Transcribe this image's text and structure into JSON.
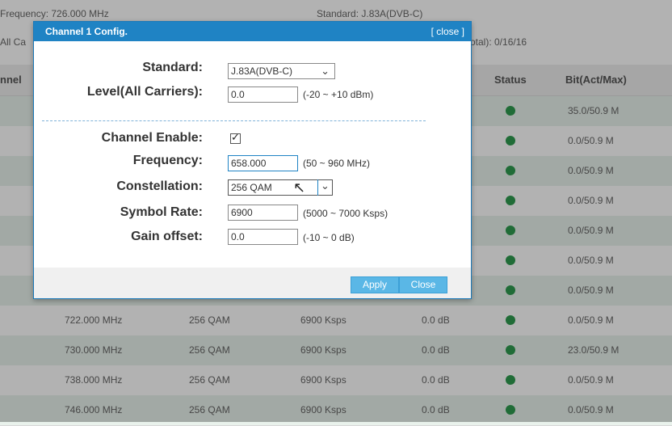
{
  "background": {
    "frequency_info": "Frequency: 726.000 MHz",
    "standard_info": "Standard: J.83A(DVB-C)",
    "carriers_info": "All Ca",
    "total_info": "otal): 0/16/16",
    "columns": {
      "channel": "nnel",
      "status": "Status",
      "bit": "Bit(Act/Max)"
    },
    "rows": [
      {
        "freq": "",
        "const": "",
        "rate": "",
        "gain": "",
        "bit": "35.0/50.9 M"
      },
      {
        "freq": "",
        "const": "",
        "rate": "",
        "gain": "",
        "bit": "0.0/50.9 M"
      },
      {
        "freq": "",
        "const": "",
        "rate": "",
        "gain": "",
        "bit": "0.0/50.9 M"
      },
      {
        "freq": "",
        "const": "",
        "rate": "",
        "gain": "",
        "bit": "0.0/50.9 M"
      },
      {
        "freq": "",
        "const": "",
        "rate": "",
        "gain": "",
        "bit": "0.0/50.9 M"
      },
      {
        "freq": "",
        "const": "",
        "rate": "",
        "gain": "",
        "bit": "0.0/50.9 M"
      },
      {
        "freq": "",
        "const": "",
        "rate": "",
        "gain": "",
        "bit": "0.0/50.9 M"
      },
      {
        "freq": "722.000 MHz",
        "const": "256 QAM",
        "rate": "6900 Ksps",
        "gain": "0.0 dB",
        "bit": "0.0/50.9 M"
      },
      {
        "freq": "730.000 MHz",
        "const": "256 QAM",
        "rate": "6900 Ksps",
        "gain": "0.0 dB",
        "bit": "23.0/50.9 M"
      },
      {
        "freq": "738.000 MHz",
        "const": "256 QAM",
        "rate": "6900 Ksps",
        "gain": "0.0 dB",
        "bit": "0.0/50.9 M"
      },
      {
        "freq": "746.000 MHz",
        "const": "256 QAM",
        "rate": "6900 Ksps",
        "gain": "0.0 dB",
        "bit": "0.0/50.9 M"
      }
    ]
  },
  "dialog": {
    "title": "Channel 1 Config.",
    "close_link": "[ close ]",
    "standard_label": "Standard:",
    "standard_value": "J.83A(DVB-C)",
    "level_label": "Level(All Carriers):",
    "level_value": "0.0",
    "level_hint": "(-20 ~ +10 dBm)",
    "enable_label": "Channel Enable:",
    "enable_checked": true,
    "frequency_label": "Frequency:",
    "frequency_value": "658.000",
    "frequency_hint": "(50 ~ 960 MHz)",
    "constellation_label": "Constellation:",
    "constellation_value": "256 QAM",
    "symbol_label": "Symbol Rate:",
    "symbol_value": "6900",
    "symbol_hint": "(5000 ~ 7000 Ksps)",
    "gain_label": "Gain offset:",
    "gain_value": "0.0",
    "gain_hint": "(-10 ~ 0 dB)",
    "apply_label": "Apply",
    "close_label": "Close"
  },
  "colors": {
    "header": "#1f83c4",
    "status_ok": "#2e9b4f",
    "button": "#5ab7e6"
  }
}
